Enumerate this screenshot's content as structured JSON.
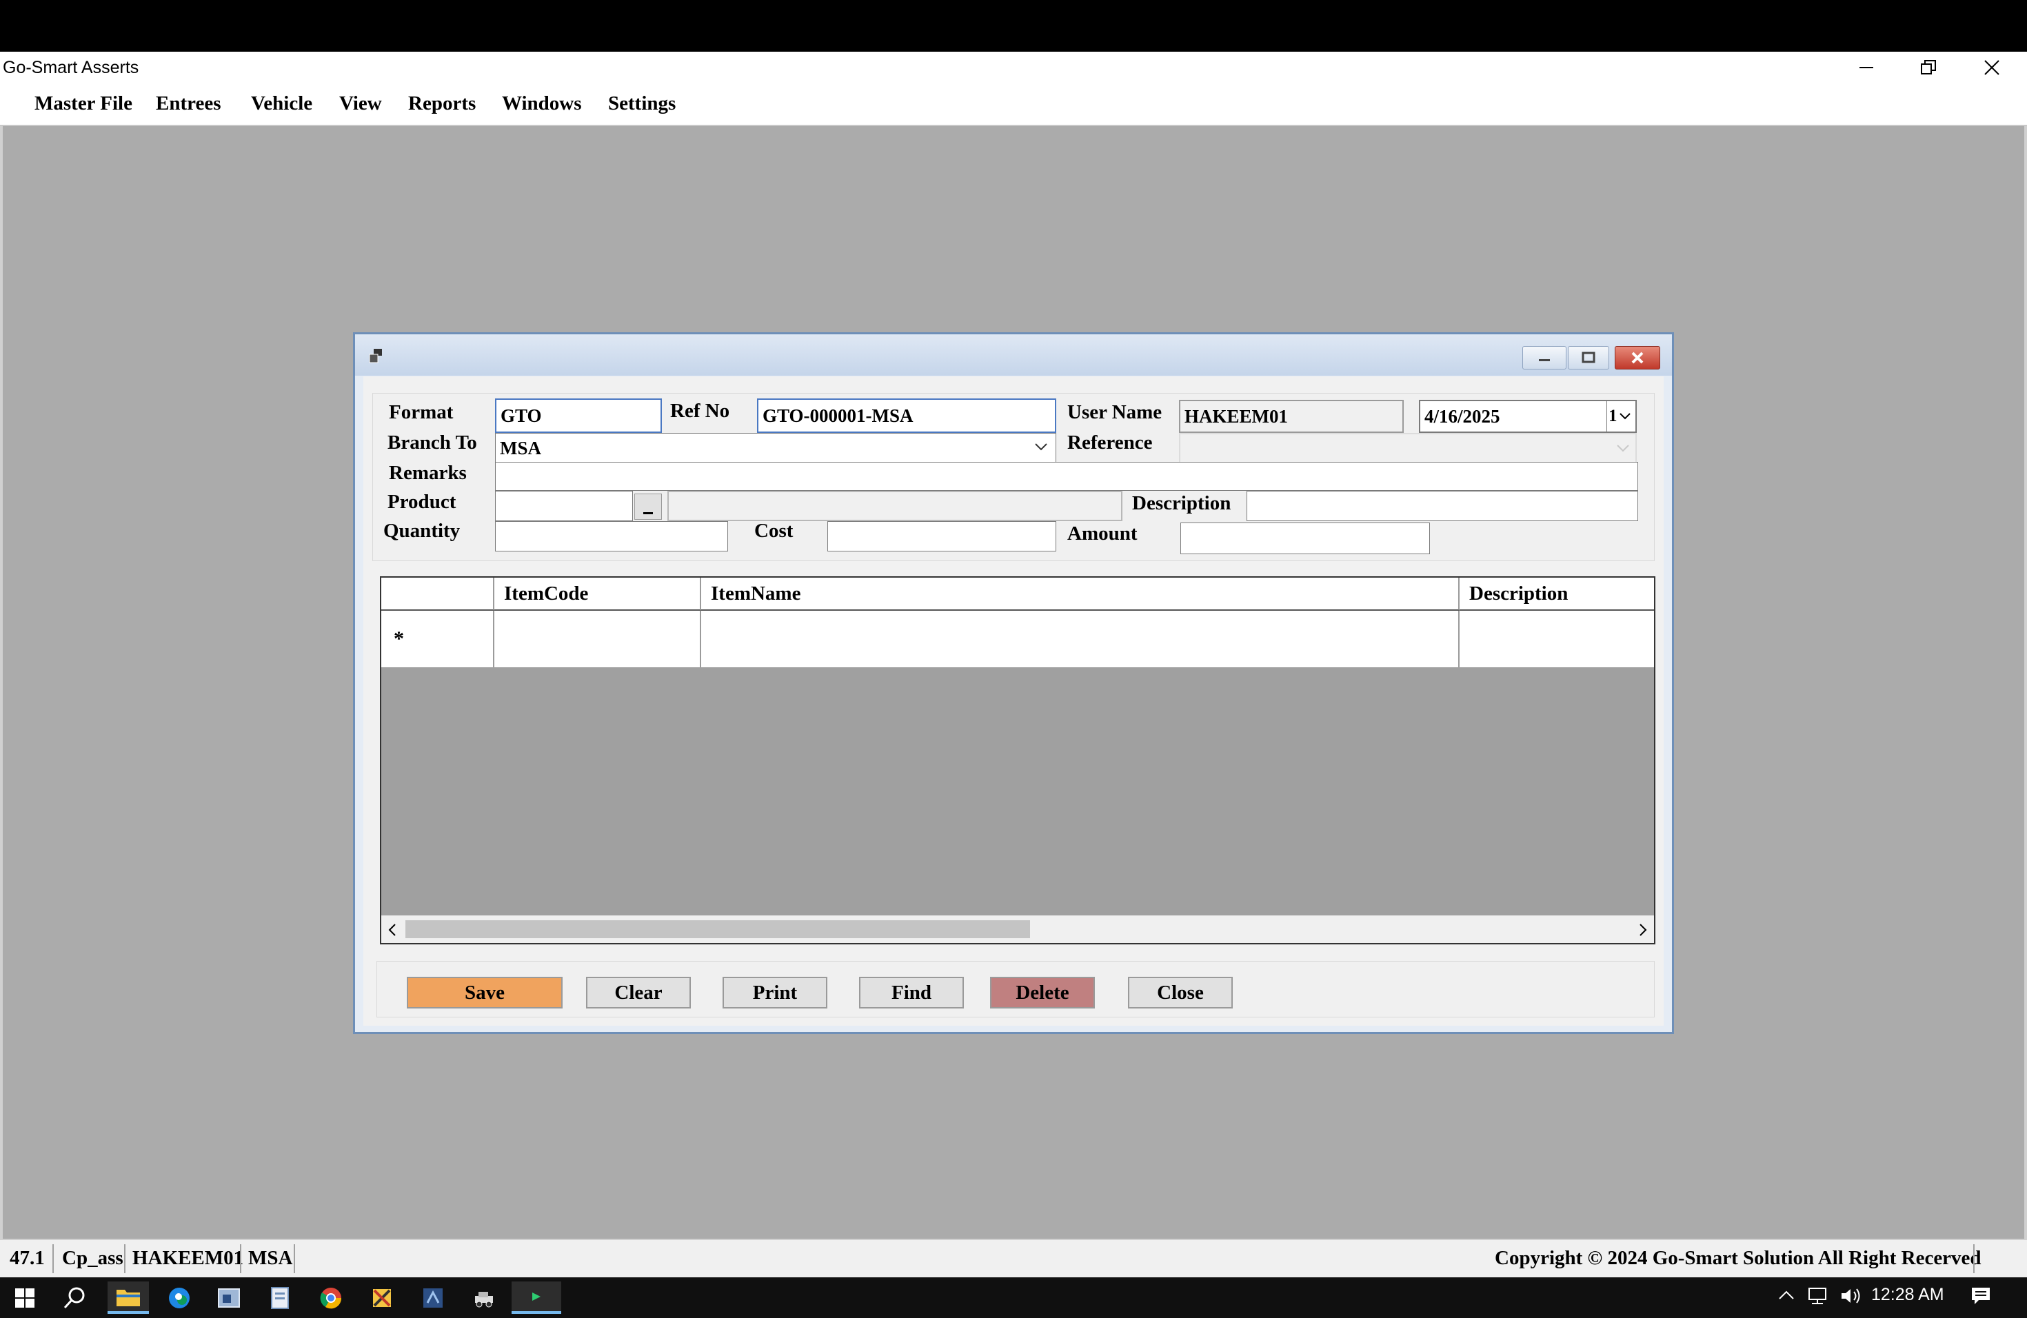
{
  "app": {
    "title": "Go-Smart Asserts",
    "menu": [
      "Master File",
      "Entrees",
      "Vehicle",
      "View",
      "Reports",
      "Windows",
      "Settings"
    ]
  },
  "form": {
    "format_label": "Format",
    "format_value": "GTO",
    "refno_label": "Ref No",
    "refno_value": "GTO-000001-MSA",
    "username_label": "User Name",
    "username_value": "HAKEEM01",
    "date_value": "4/16/2025",
    "date_spin": "1",
    "branch_label": "Branch To",
    "branch_value": "MSA",
    "reference_label": "Reference",
    "remarks_label": "Remarks",
    "product_label": "Product",
    "description_label": "Description",
    "quantity_label": "Quantity",
    "cost_label": "Cost",
    "amount_label": "Amount"
  },
  "grid": {
    "columns": [
      "ItemCode",
      "ItemName",
      "Description"
    ],
    "new_row_marker": "*"
  },
  "buttons": {
    "save": "Save",
    "clear": "Clear",
    "print": "Print",
    "find": "Find",
    "delete": "Delete",
    "close": "Close"
  },
  "status": {
    "version": "47.1",
    "db": "Cp_ass",
    "user": "HAKEEM01",
    "branch": "MSA",
    "copyright": "Copyright © 2024 Go-Smart Solution All Right Recerved"
  },
  "taskbar": {
    "time": "12:28 AM"
  },
  "colors": {
    "save_button": "#f0a35e",
    "delete_button": "#c08080",
    "mdi_background": "#ababab",
    "grid_background": "#a0a0a0"
  }
}
